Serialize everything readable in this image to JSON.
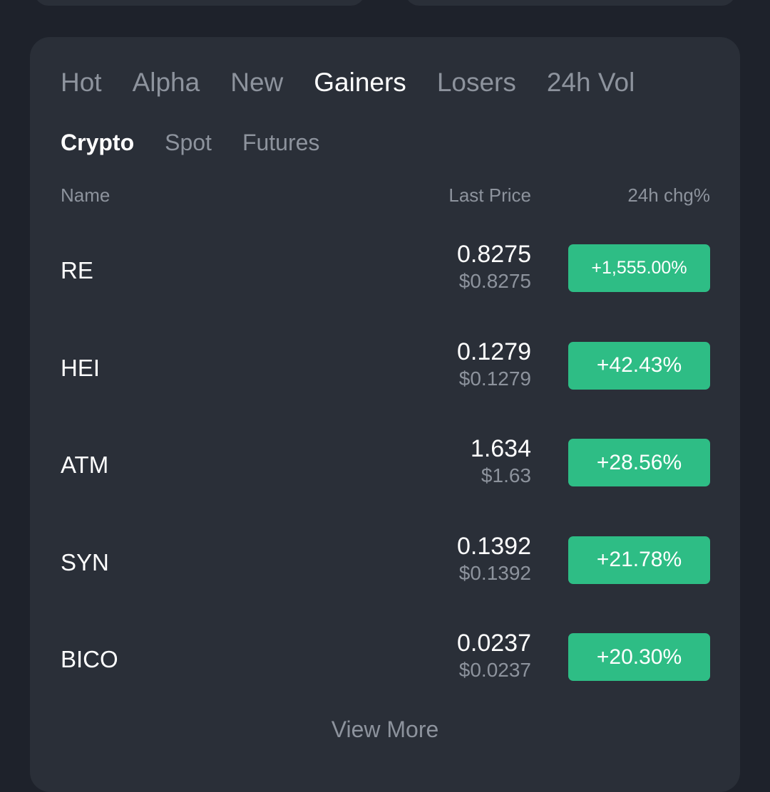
{
  "tabs": [
    "Hot",
    "Alpha",
    "New",
    "Gainers",
    "Losers",
    "24h Vol"
  ],
  "active_tab": "Gainers",
  "subtabs": [
    "Crypto",
    "Spot",
    "Futures"
  ],
  "active_subtab": "Crypto",
  "columns": {
    "name": "Name",
    "last_price": "Last Price",
    "change": "24h chg%"
  },
  "rows": [
    {
      "name": "RE",
      "price": "0.8275",
      "usd": "$0.8275",
      "change": "+1,555.00%"
    },
    {
      "name": "HEI",
      "price": "0.1279",
      "usd": "$0.1279",
      "change": "+42.43%"
    },
    {
      "name": "ATM",
      "price": "1.634",
      "usd": "$1.63",
      "change": "+28.56%"
    },
    {
      "name": "SYN",
      "price": "0.1392",
      "usd": "$0.1392",
      "change": "+21.78%"
    },
    {
      "name": "BICO",
      "price": "0.0237",
      "usd": "$0.0237",
      "change": "+20.30%"
    }
  ],
  "view_more": "View More",
  "colors": {
    "background": "#1e222b",
    "panel": "#2a2f38",
    "positive": "#2ebd85",
    "muted_text": "#8d939d",
    "primary_text": "#ffffff"
  }
}
